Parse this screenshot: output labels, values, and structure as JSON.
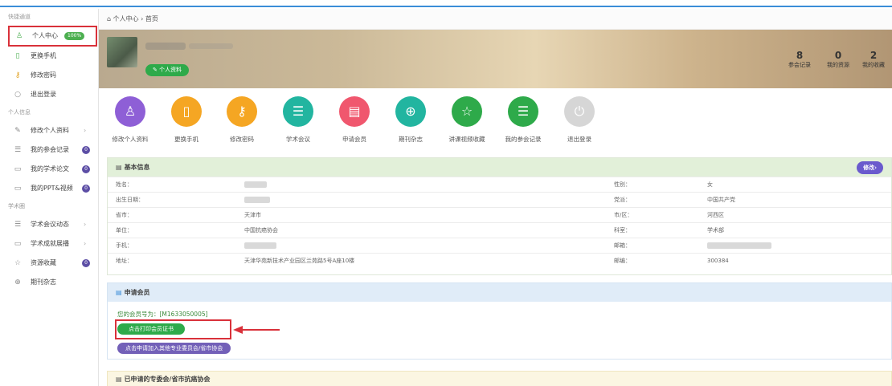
{
  "breadcrumb": {
    "home": "个人中心",
    "sep": "›",
    "current": "首页"
  },
  "sidebar": {
    "sections": [
      {
        "title": "快捷通道"
      },
      {
        "title": "个人信息"
      },
      {
        "title": "学术圈"
      }
    ],
    "items": [
      {
        "label": "个人中心",
        "badge": "100%",
        "icon": "user-icon"
      },
      {
        "label": "更换手机",
        "icon": "phone-icon"
      },
      {
        "label": "修改密码",
        "icon": "key-icon"
      },
      {
        "label": "退出登录",
        "icon": "circle-icon"
      },
      {
        "label": "修改个人资料",
        "arrow": "›",
        "icon": "pencil-icon"
      },
      {
        "label": "我的参会记录",
        "count": "0",
        "icon": "list-icon"
      },
      {
        "label": "我的学术论文",
        "count": "0",
        "icon": "folder-icon"
      },
      {
        "label": "我的PPT&视频",
        "count": "0",
        "icon": "video-icon"
      },
      {
        "label": "学术会议动态",
        "arrow": "›",
        "icon": "list-icon"
      },
      {
        "label": "学术成就展播",
        "arrow": "›",
        "icon": "video-icon"
      },
      {
        "label": "资源收藏",
        "count": "0",
        "icon": "star-icon"
      },
      {
        "label": "期刊杂志",
        "icon": "target-icon"
      }
    ]
  },
  "banner": {
    "profile_button": "个人资料",
    "stats": [
      {
        "num": "8",
        "label": "参会记录"
      },
      {
        "num": "0",
        "label": "我的资源"
      },
      {
        "num": "2",
        "label": "我的收藏"
      }
    ]
  },
  "quick_icons": [
    {
      "label": "修改个人资料",
      "color": "#8e5fd6",
      "glyph": "♙"
    },
    {
      "label": "更换手机",
      "color": "#f5a623",
      "glyph": "▯"
    },
    {
      "label": "修改密码",
      "color": "#f5a623",
      "glyph": "⚷"
    },
    {
      "label": "学术会议",
      "color": "#22b5a0",
      "glyph": "☰"
    },
    {
      "label": "申请会员",
      "color": "#f0576e",
      "glyph": "▤"
    },
    {
      "label": "期刊杂志",
      "color": "#22b5a0",
      "glyph": "⊕"
    },
    {
      "label": "讲课视频收藏",
      "color": "#2eaa4a",
      "glyph": "☆"
    },
    {
      "label": "我的参会记录",
      "color": "#2eaa4a",
      "glyph": "☰"
    },
    {
      "label": "退出登录",
      "color": "#d6d6d6",
      "glyph": "⏻"
    }
  ],
  "basic_info": {
    "title": "基本信息",
    "edit": "修改›",
    "rows": [
      {
        "k1": "姓名：",
        "v1": "",
        "k2": "性别：",
        "v2": "女"
      },
      {
        "k1": "出生日期：",
        "v1": "",
        "k2": "党派：",
        "v2": "中国共产党"
      },
      {
        "k1": "省市：",
        "v1": "天津市",
        "k2": "市/区：",
        "v2": "河西区"
      },
      {
        "k1": "单位：",
        "v1": "中国抗癌协会",
        "k2": "科室：",
        "v2": "学术部"
      },
      {
        "k1": "手机：",
        "v1": "",
        "k2": "邮箱：",
        "v2": ""
      },
      {
        "k1": "地址：",
        "v1": "天津华苑新技术产业园区兰苑路5号A座10楼",
        "k2": "邮编：",
        "v2": "300384"
      }
    ]
  },
  "member": {
    "title": "申请会员",
    "number_line": "您的会员号为：[M1633050005]",
    "print_button": "点击打印会员证书",
    "join_button": "点击申请加入其他专业委员会/省市协会"
  },
  "applied": {
    "title": "已申请的专委会/省市抗癌协会"
  },
  "colors": {
    "accent_red": "#d9313a",
    "green": "#2eaa4a",
    "purple": "#6a5acd"
  }
}
